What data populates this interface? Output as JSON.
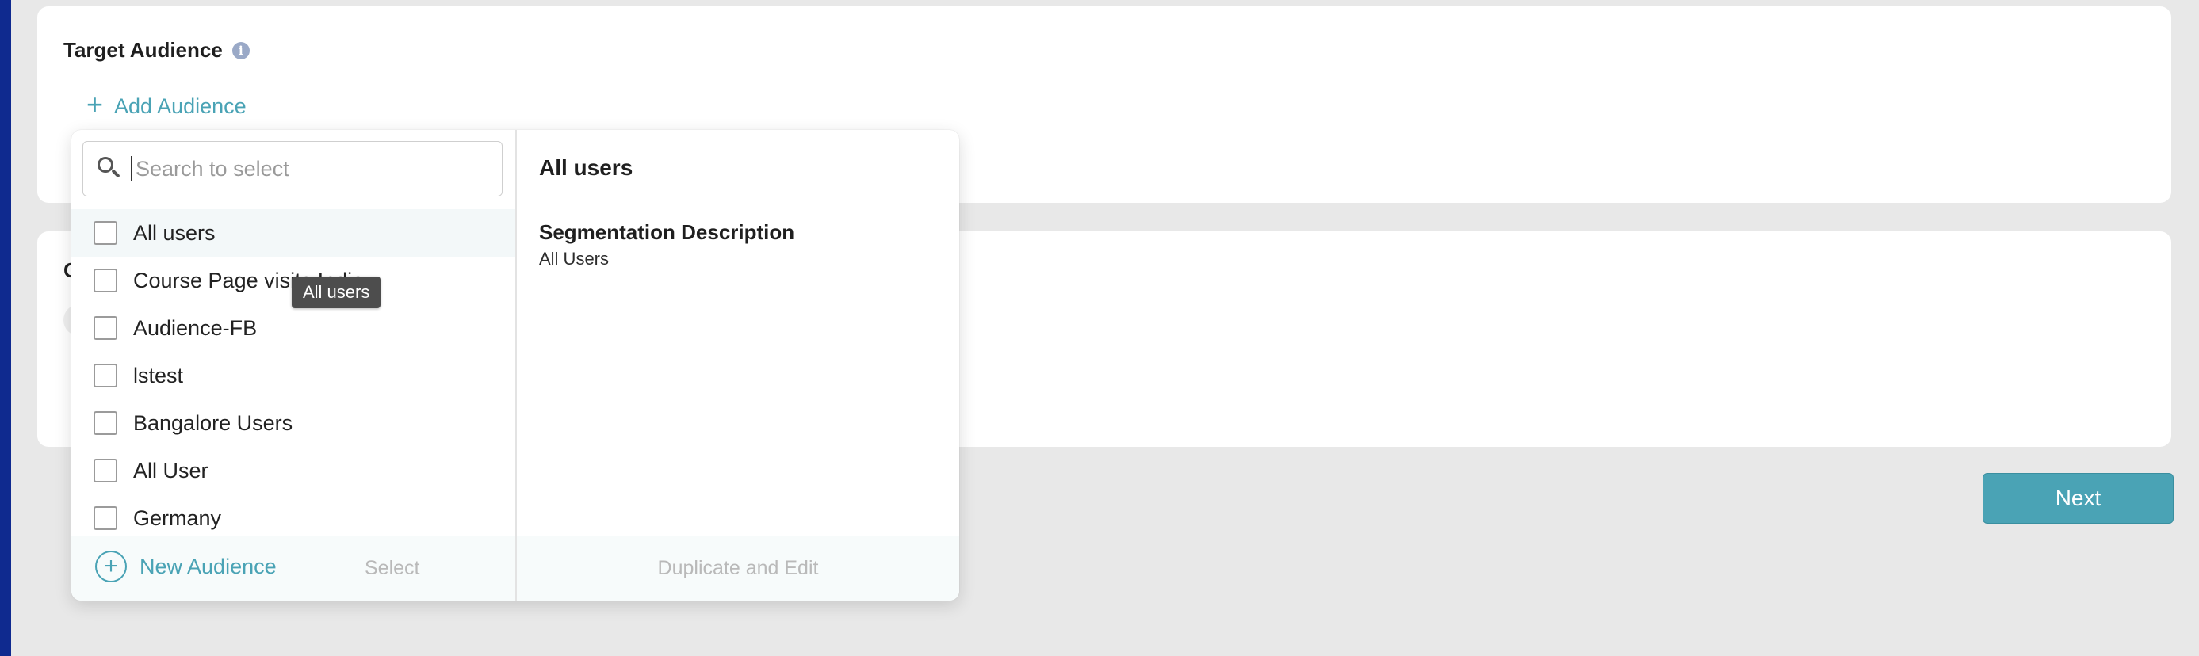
{
  "target_audience": {
    "title": "Target Audience",
    "info_icon": "info-icon",
    "add_label": "Add Audience"
  },
  "second_card": {
    "title_partial": "C"
  },
  "dropdown": {
    "search_placeholder": "Search to select",
    "options": [
      {
        "label": "All users",
        "checked": false
      },
      {
        "label": "Course Page visits India",
        "checked": false
      },
      {
        "label": "Audience-FB",
        "checked": false
      },
      {
        "label": "lstest",
        "checked": false
      },
      {
        "label": "Bangalore Users",
        "checked": false
      },
      {
        "label": "All User",
        "checked": false
      },
      {
        "label": "Germany",
        "checked": false
      }
    ],
    "new_audience_label": "New Audience",
    "select_label": "Select",
    "detail": {
      "title": "All users",
      "segmentation_label": "Segmentation Description",
      "segmentation_value": "All Users",
      "duplicate_label": "Duplicate and Edit"
    }
  },
  "tooltip_text": "All users",
  "next_label": "Next",
  "colors": {
    "accent": "#4aa3b5",
    "rail": "#0f2a8f"
  }
}
